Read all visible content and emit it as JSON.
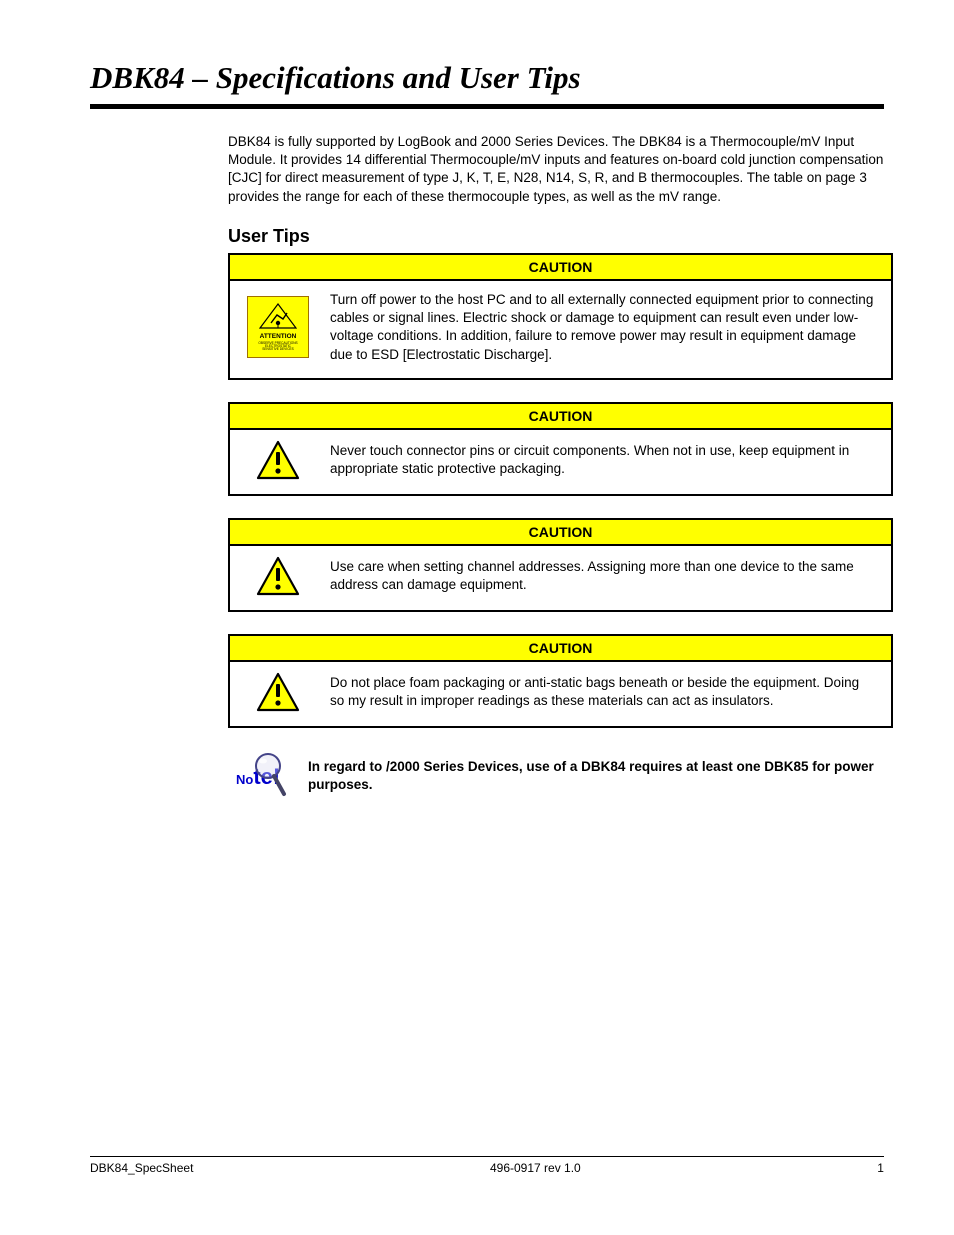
{
  "header": {
    "title": "DBK84 – Specifications and User Tips"
  },
  "intro": "DBK84 is fully supported by LogBook and 2000 Series Devices. The DBK84 is a Thermocouple/mV Input Module. It provides 14 differential Thermocouple/mV inputs and features on-board cold junction compensation [CJC] for direct measurement of type J, K, T, E, N28, N14, S, R, and B thermocouples. The table on page 3 provides the range for each of these thermocouple types, as well as the mV range.",
  "userTipsHeading": "User Tips",
  "cautions": [
    {
      "title": "CAUTION",
      "iconType": "esd",
      "text": "Turn off power to the host PC and to all externally connected equipment prior to connecting cables or signal lines. Electric shock or damage to equipment can result even under low-voltage conditions. In addition, failure to remove power may result in equipment damage due to ESD [Electrostatic Discharge]."
    },
    {
      "title": "CAUTION",
      "iconType": "triangle",
      "text": "Never touch connector pins or circuit components. When not in use, keep equipment in appropriate static protective packaging."
    },
    {
      "title": "CAUTION",
      "iconType": "triangle",
      "text": "Use care when setting channel addresses. Assigning more than one device to the same address can damage equipment."
    },
    {
      "title": "CAUTION",
      "iconType": "triangle",
      "text": "Do not place foam packaging or anti-static bags beneath or beside the equipment. Doing so my result in improper readings as these materials can act as insulators."
    }
  ],
  "note": {
    "label": "Note!",
    "text": "In regard to /2000 Series Devices, use of a DBK84 requires at least one DBK85 for power purposes."
  },
  "footer": {
    "left": "DBK84_SpecSheet",
    "center": "496-0917 rev 1.0",
    "right": "1"
  }
}
